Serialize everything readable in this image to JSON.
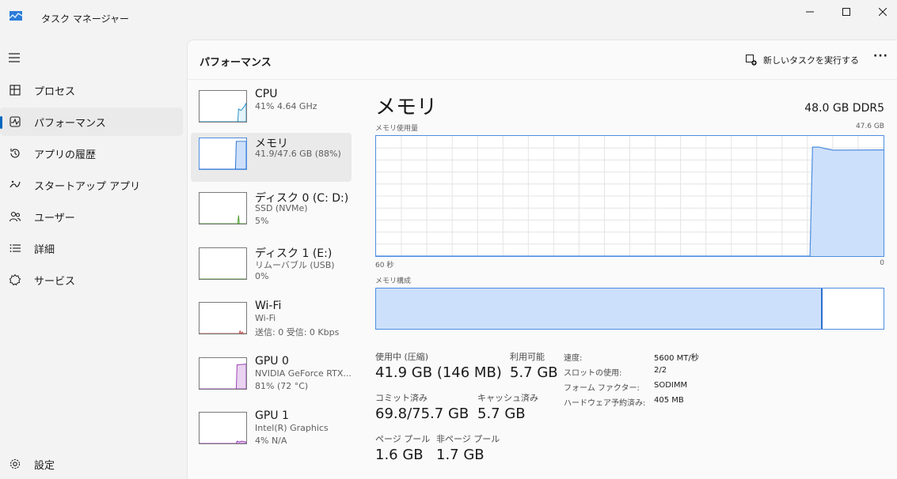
{
  "window": {
    "title": "タスク マネージャー",
    "minimize_icon": "minimize-icon",
    "maximize_icon": "maximize-icon",
    "close_icon": "close-icon"
  },
  "nav": {
    "items": [
      {
        "label": "プロセス",
        "icon": "processes-icon"
      },
      {
        "label": "パフォーマンス",
        "icon": "performance-icon",
        "active": true
      },
      {
        "label": "アプリの履歴",
        "icon": "history-icon"
      },
      {
        "label": "スタートアップ アプリ",
        "icon": "startup-icon"
      },
      {
        "label": "ユーザー",
        "icon": "users-icon"
      },
      {
        "label": "詳細",
        "icon": "details-icon"
      },
      {
        "label": "サービス",
        "icon": "services-icon"
      }
    ],
    "settings_label": "設定"
  },
  "header": {
    "title": "パフォーマンス",
    "run_task_label": "新しいタスクを実行する",
    "more_label": "···"
  },
  "devices": [
    {
      "name": "CPU",
      "sub1": "41% 4.64 GHz",
      "sub2": "",
      "color": "#1e90c8",
      "fill": "#e6f3fa"
    },
    {
      "name": "メモリ",
      "sub1": "41.9/47.6 GB (88%)",
      "sub2": "",
      "color": "#2c6fd0",
      "fill": "#cde0fb",
      "active": true
    },
    {
      "name": "ディスク 0 (C: D:)",
      "sub1": "SSD (NVMe)",
      "sub2": "5%",
      "color": "#4a9a2a",
      "fill": "#e4f2da"
    },
    {
      "name": "ディスク 1 (E:)",
      "sub1": "リムーバブル (USB)",
      "sub2": "0%",
      "color": "#4a9a2a",
      "fill": "#e4f2da"
    },
    {
      "name": "Wi-Fi",
      "sub1": "Wi-Fi",
      "sub2": "送信: 0 受信: 0 Kbps",
      "color": "#c0504d",
      "fill": "#f7e4e3"
    },
    {
      "name": "GPU 0",
      "sub1": "NVIDIA GeForce RTX...",
      "sub2": "81% (72 °C)",
      "color": "#9b3fb5",
      "fill": "#e9d3f1"
    },
    {
      "name": "GPU 1",
      "sub1": "Intel(R) Graphics",
      "sub2": "4% N/A",
      "color": "#9b3fb5",
      "fill": "#e9d3f1"
    }
  ],
  "detail": {
    "title": "メモリ",
    "spec": "48.0 GB DDR5",
    "usage_label": "メモリ使用量",
    "usage_max": "47.6 GB",
    "time_left": "60 秒",
    "time_right": "0",
    "composition_label": "メモリ構成",
    "composition_used_fraction": 0.88,
    "stats": {
      "in_use_label": "使用中 (圧縮)",
      "in_use_value": "41.9 GB (146 MB)",
      "available_label": "利用可能",
      "available_value": "5.7 GB",
      "committed_label": "コミット済み",
      "committed_value": "69.8/75.7 GB",
      "cached_label": "キャッシュ済み",
      "cached_value": "5.7 GB",
      "paged_label": "ページ プール",
      "paged_value": "1.6 GB",
      "nonpaged_label": "非ページ プール",
      "nonpaged_value": "1.7 GB"
    },
    "properties": [
      {
        "key": "速度:",
        "value": "5600 MT/秒"
      },
      {
        "key": "スロットの使用:",
        "value": "2/2"
      },
      {
        "key": "フォーム ファクター:",
        "value": "SODIMM"
      },
      {
        "key": "ハードウェア予約済み:",
        "value": "405 MB"
      }
    ]
  },
  "chart_data": {
    "type": "area",
    "title": "メモリ使用量",
    "xlabel": "",
    "ylabel": "",
    "x_range": [
      "60 秒",
      "0"
    ],
    "ylim": [
      0,
      47.6
    ],
    "grid": true,
    "series": [
      {
        "x": [
          60,
          8.7,
          8.4,
          7.6,
          6.9,
          6.0,
          4.5,
          0
        ],
        "values": [
          0,
          0,
          43.2,
          43.2,
          42.6,
          42.0,
          42.0,
          42.1
        ]
      }
    ]
  }
}
